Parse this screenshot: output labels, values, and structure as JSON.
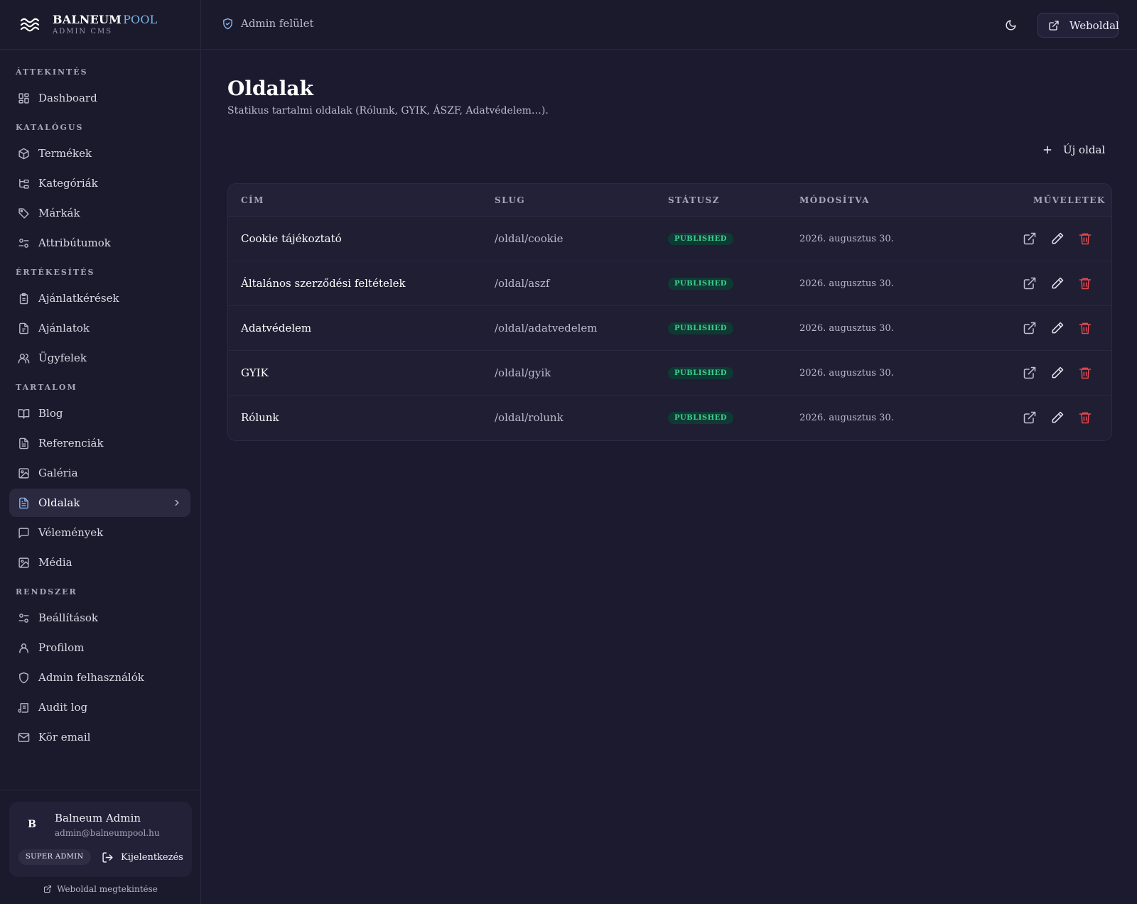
{
  "brand": {
    "name_part1": "BALNEUM",
    "name_part2": "POOL",
    "subtitle": "ADMIN CMS",
    "logo_icon": "waves-icon"
  },
  "sidebar": {
    "sections": [
      {
        "title": "ÁTTEKINTÉS",
        "items": [
          {
            "label": "Dashboard",
            "icon": "dashboard-icon"
          }
        ]
      },
      {
        "title": "KATALÓGUS",
        "items": [
          {
            "label": "Termékek",
            "icon": "box-icon"
          },
          {
            "label": "Kategóriák",
            "icon": "tree-icon"
          },
          {
            "label": "Márkák",
            "icon": "tag-icon"
          },
          {
            "label": "Attribútumok",
            "icon": "sliders-icon"
          }
        ]
      },
      {
        "title": "ÉRTÉKESÍTÉS",
        "items": [
          {
            "label": "Ajánlatkérések",
            "icon": "clipboard-icon"
          },
          {
            "label": "Ajánlatok",
            "icon": "file-icon"
          },
          {
            "label": "Ügyfelek",
            "icon": "users-icon"
          }
        ]
      },
      {
        "title": "TARTALOM",
        "items": [
          {
            "label": "Blog",
            "icon": "book-icon"
          },
          {
            "label": "Referenciák",
            "icon": "file-text-icon"
          },
          {
            "label": "Galéria",
            "icon": "image-icon"
          },
          {
            "label": "Oldalak",
            "icon": "file-text-icon",
            "active": true
          },
          {
            "label": "Vélemények",
            "icon": "message-icon"
          },
          {
            "label": "Média",
            "icon": "image-icon"
          }
        ]
      },
      {
        "title": "RENDSZER",
        "items": [
          {
            "label": "Beállítások",
            "icon": "sliders-icon"
          },
          {
            "label": "Profilom",
            "icon": "user-icon"
          },
          {
            "label": "Admin felhasználók",
            "icon": "shield-icon"
          },
          {
            "label": "Audit log",
            "icon": "scroll-icon"
          },
          {
            "label": "Kör email",
            "icon": "mail-icon"
          }
        ]
      }
    ]
  },
  "user": {
    "initial": "B",
    "name": "Balneum Admin",
    "email": "admin@balneumpool.hu",
    "role": "SUPER ADMIN",
    "logout_label": "Kijelentkezés",
    "site_preview_label": "Weboldal megtekintése"
  },
  "topbar": {
    "breadcrumb": "Admin felület",
    "site_button": "Weboldal"
  },
  "page": {
    "title": "Oldalak",
    "subtitle": "Statikus tartalmi oldalak (Rólunk, GYIK, ÁSZF, Adatvédelem…).",
    "new_button": "Új oldal"
  },
  "table": {
    "columns": [
      "CÍM",
      "SLUG",
      "STÁTUSZ",
      "MÓDOSÍTVA",
      "MŰVELETEK"
    ],
    "rows": [
      {
        "title": "Cookie tájékoztató",
        "slug": "/oldal/cookie",
        "status": "PUBLISHED",
        "modified": "2026. augusztus 30."
      },
      {
        "title": "Általános szerződési feltételek",
        "slug": "/oldal/aszf",
        "status": "PUBLISHED",
        "modified": "2026. augusztus 30."
      },
      {
        "title": "Adatvédelem",
        "slug": "/oldal/adatvedelem",
        "status": "PUBLISHED",
        "modified": "2026. augusztus 30."
      },
      {
        "title": "GYIK",
        "slug": "/oldal/gyik",
        "status": "PUBLISHED",
        "modified": "2026. augusztus 30."
      },
      {
        "title": "Rólunk",
        "slug": "/oldal/rolunk",
        "status": "PUBLISHED",
        "modified": "2026. augusztus 30."
      }
    ]
  },
  "colors": {
    "background": "#1c1a2e",
    "accent": "#8fb3ea",
    "brand_accent": "#7ab6e6",
    "published": "#3fce8e",
    "danger": "#e5484d"
  }
}
